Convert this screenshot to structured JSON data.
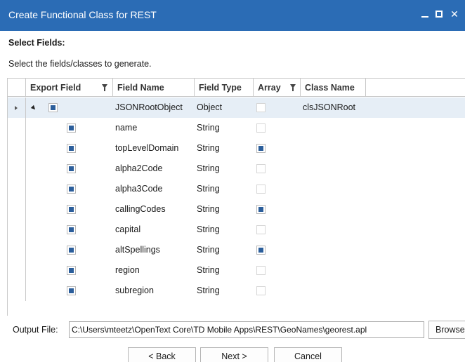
{
  "window": {
    "title": "Create Functional Class for REST"
  },
  "section_title": "Select Fields:",
  "instruction": "Select the fields/classes to generate.",
  "grid": {
    "columns": [
      {
        "label": "Export Field",
        "filter": true
      },
      {
        "label": "Field Name",
        "filter": false
      },
      {
        "label": "Field Type",
        "filter": false
      },
      {
        "label": "Array",
        "filter": true
      },
      {
        "label": "Class Name",
        "filter": false
      }
    ],
    "rows": [
      {
        "export": true,
        "field_name": "JSONRootObject",
        "field_type": "Object",
        "array": false,
        "class_name": "clsJSONRoot",
        "is_root": true,
        "selected": true
      },
      {
        "export": true,
        "field_name": "name",
        "field_type": "String",
        "array": false,
        "class_name": ""
      },
      {
        "export": true,
        "field_name": "topLevelDomain",
        "field_type": "String",
        "array": true,
        "class_name": ""
      },
      {
        "export": true,
        "field_name": "alpha2Code",
        "field_type": "String",
        "array": false,
        "class_name": ""
      },
      {
        "export": true,
        "field_name": "alpha3Code",
        "field_type": "String",
        "array": false,
        "class_name": ""
      },
      {
        "export": true,
        "field_name": "callingCodes",
        "field_type": "String",
        "array": true,
        "class_name": ""
      },
      {
        "export": true,
        "field_name": "capital",
        "field_type": "String",
        "array": false,
        "class_name": ""
      },
      {
        "export": true,
        "field_name": "altSpellings",
        "field_type": "String",
        "array": true,
        "class_name": ""
      },
      {
        "export": true,
        "field_name": "region",
        "field_type": "String",
        "array": false,
        "class_name": ""
      },
      {
        "export": true,
        "field_name": "subregion",
        "field_type": "String",
        "array": false,
        "class_name": ""
      }
    ]
  },
  "output": {
    "label": "Output File:",
    "value": "C:\\Users\\mteetz\\OpenText Core\\TD Mobile Apps\\REST\\GeoNames\\georest.apl",
    "browse_label": "Browse..."
  },
  "buttons": {
    "back": "< Back",
    "next": "Next >",
    "cancel": "Cancel"
  }
}
